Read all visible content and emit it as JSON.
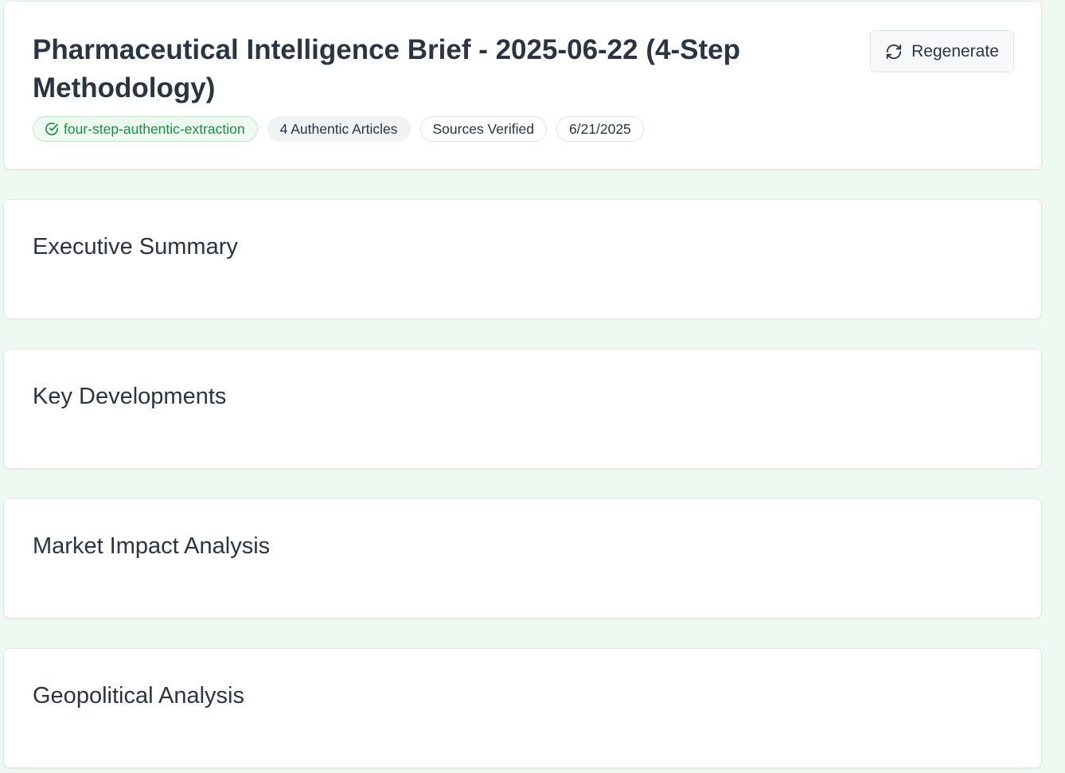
{
  "brief": {
    "title": "Pharmaceutical Intelligence Brief - 2025-06-22 (4-Step Methodology)",
    "regenerate_label": "Regenerate",
    "badges": {
      "methodology": "four-step-authentic-extraction",
      "articles": "4 Authentic Articles",
      "sources": "Sources Verified",
      "date": "6/21/2025"
    }
  },
  "sections": [
    {
      "title": "Executive Summary"
    },
    {
      "title": "Key Developments"
    },
    {
      "title": "Market Impact Analysis"
    },
    {
      "title": "Geopolitical Analysis"
    }
  ],
  "colors": {
    "background": "#eefaf1",
    "text": "#2b3442",
    "methodology_badge": "#1f8a42"
  },
  "icons": {
    "regenerate": "refresh-icon",
    "methodology": "check-circle-icon"
  }
}
